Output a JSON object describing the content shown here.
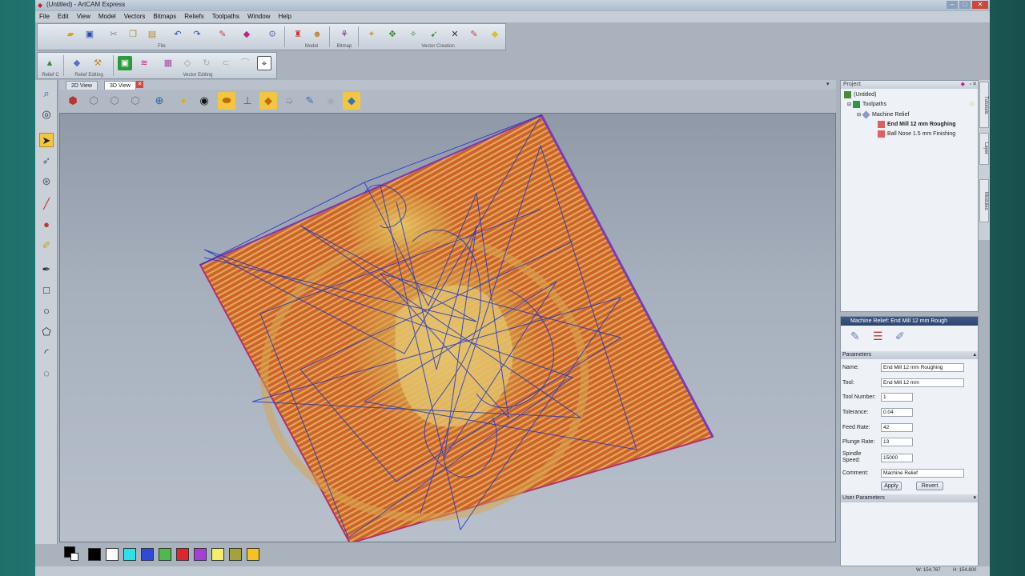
{
  "window": {
    "title": "(Untitled) - ArtCAM Express"
  },
  "menu": [
    "File",
    "Edit",
    "View",
    "Model",
    "Vectors",
    "Bitmaps",
    "Reliefs",
    "Toolpaths",
    "Window",
    "Help"
  ],
  "toolbar_groups": {
    "file": "File",
    "model": "Model",
    "bitmap": "Bitmap",
    "vector_creation": "Vector Creation",
    "relief_c": "Relief C",
    "relief_editing": "Relief Editing",
    "vector_editing": "Vector Editing"
  },
  "view_tabs": [
    "2D View",
    "3D View"
  ],
  "palette": [
    "#000000",
    "#ffffff",
    "#27e3ea",
    "#2e4ad8",
    "#4cbb47",
    "#e3242b",
    "#a83ed8",
    "#f4ef63",
    "#a6a23a",
    "#f5c31a"
  ],
  "project": {
    "header": "Project",
    "root": "(Untitled)",
    "toolpaths": "Toolpaths",
    "group": "Machine Relief",
    "items": [
      "End Mill 12 mm Roughing",
      "Ball Nose 1.5 mm Finishing"
    ]
  },
  "side_tabs": [
    "Tutorials",
    "Layer",
    "Modules"
  ],
  "props": {
    "title": "Machine Relief: End Mill 12 mm Rough",
    "section": "Parameters",
    "name_label": "Name:",
    "name_value": "End Mill 12 mm Roughing",
    "tool_label": "Tool:",
    "tool_value": "End Mill 12 mm",
    "toolnum_label": "Tool Number:",
    "toolnum_value": "1",
    "tolerance_label": "Tolerance:",
    "tolerance_value": "0.04",
    "feed_label": "Feed Rate:",
    "feed_value": "42",
    "plunge_label": "Plunge Rate:",
    "plunge_value": "13",
    "spindle_label_1": "Spindle",
    "spindle_label_2": "Speed:",
    "spindle_value": "15000",
    "comment_label": "Comment:",
    "comment_value": "Machine Relief",
    "apply": "Apply",
    "revert": "Revert",
    "user_section": "User Parameters"
  },
  "status": {
    "w": "W: 154.767",
    "h": "H: 154.800"
  }
}
